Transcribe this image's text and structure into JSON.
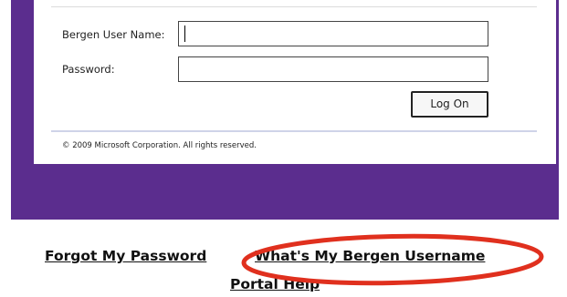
{
  "login": {
    "username_label": "Bergen User Name:",
    "username_value": "",
    "password_label": "Password:",
    "password_value": "",
    "logon_button": "Log On",
    "copyright": "© 2009 Microsoft Corporation. All rights reserved."
  },
  "links": {
    "forgot_password": "Forgot My Password",
    "whats_my_username": "What's My Bergen Username",
    "portal_help": "Portal Help"
  },
  "colors": {
    "band": "#5b2d8e",
    "highlight": "#e0301e",
    "link": "#111111"
  }
}
